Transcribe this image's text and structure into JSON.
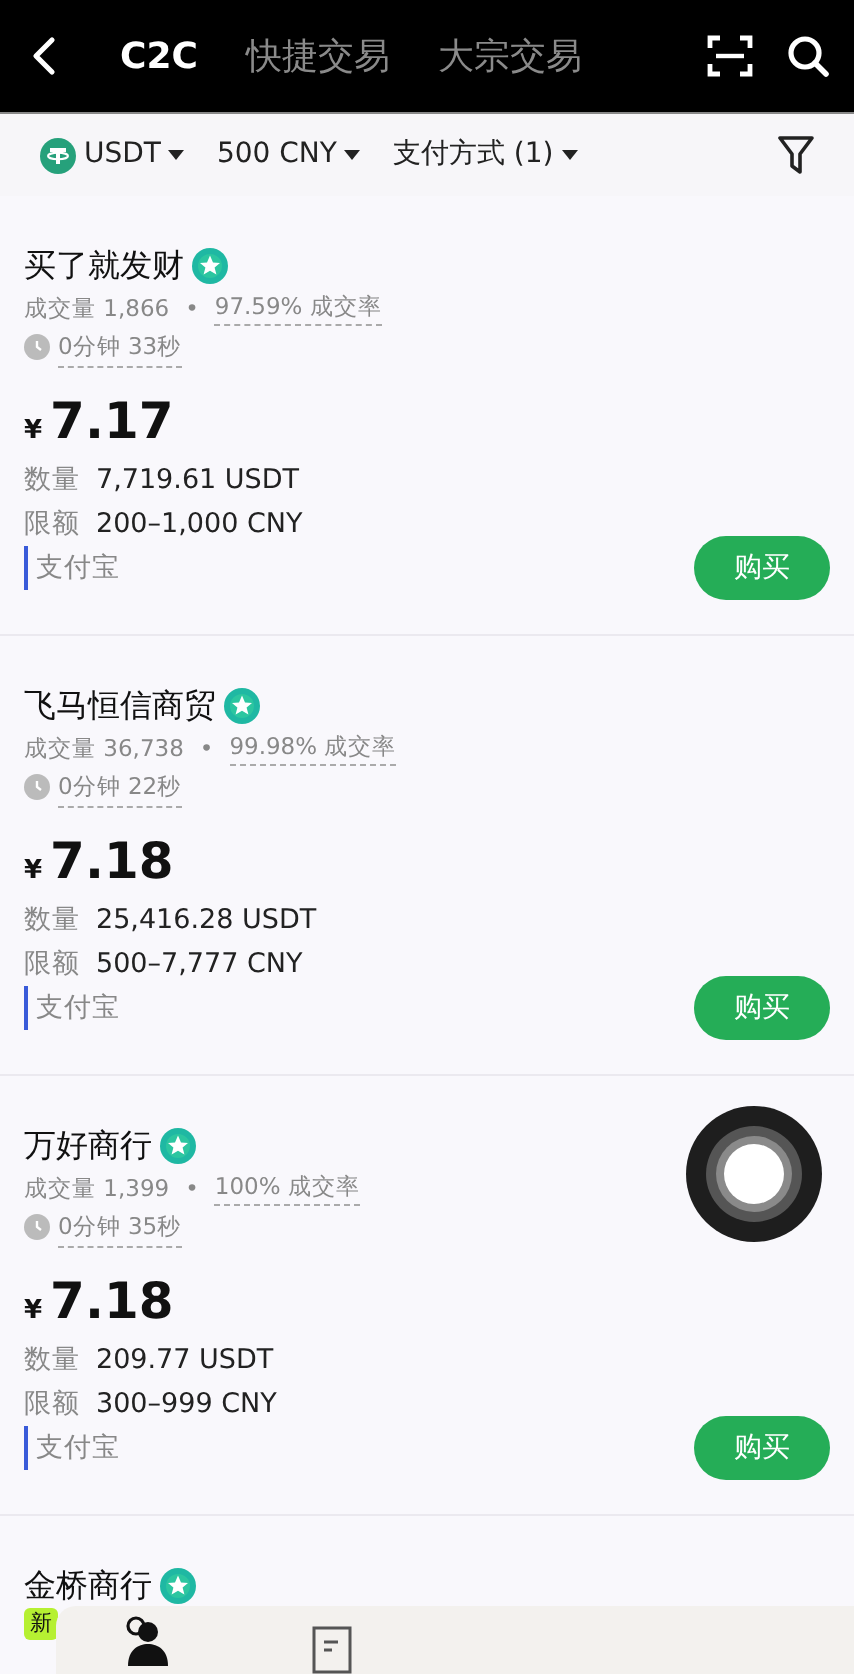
{
  "header": {
    "tabs": [
      {
        "label": "C2C",
        "selected": true
      },
      {
        "label": "快捷交易",
        "selected": false
      },
      {
        "label": "大宗交易",
        "selected": false
      }
    ]
  },
  "filters": [
    {
      "label": "USDT",
      "kind": "coin"
    },
    {
      "label": "500 CNY",
      "kind": "plain"
    },
    {
      "label": "支付方式 (1)",
      "kind": "plain"
    }
  ],
  "listings": [
    {
      "name": "买了就发财",
      "verified": true,
      "volume": "成交量 1,866",
      "separator": "•",
      "rate": "97.59% 成交率",
      "time": "0分钟 33秒",
      "currency": "¥",
      "price": "7.17",
      "qty_label": "数量",
      "qty": "7,719.61 USDT",
      "limit_label": "限额",
      "limit": "200–1,000 CNY",
      "payment": "支付宝",
      "button": "购买"
    },
    {
      "name": "飞马恒信商贸",
      "verified": true,
      "volume": "成交量 36,738",
      "separator": "•",
      "rate": "99.98% 成交率",
      "time": "0分钟 22秒",
      "currency": "¥",
      "price": "7.18",
      "qty_label": "数量",
      "qty": "25,416.28 USDT",
      "limit_label": "限额",
      "limit": "500–7,777 CNY",
      "payment": "支付宝",
      "button": "购买"
    },
    {
      "name": "万好商行",
      "verified": true,
      "volume": "成交量 1,399",
      "separator": "•",
      "rate": "100% 成交率",
      "time": "0分钟 35秒",
      "currency": "¥",
      "price": "7.18",
      "qty_label": "数量",
      "qty": "209.77 USDT",
      "limit_label": "限额",
      "limit": "300–999 CNY",
      "payment": "支付宝",
      "button": "购买"
    },
    {
      "name": "金桥商行",
      "verified": true,
      "tag": "新"
    }
  ]
}
